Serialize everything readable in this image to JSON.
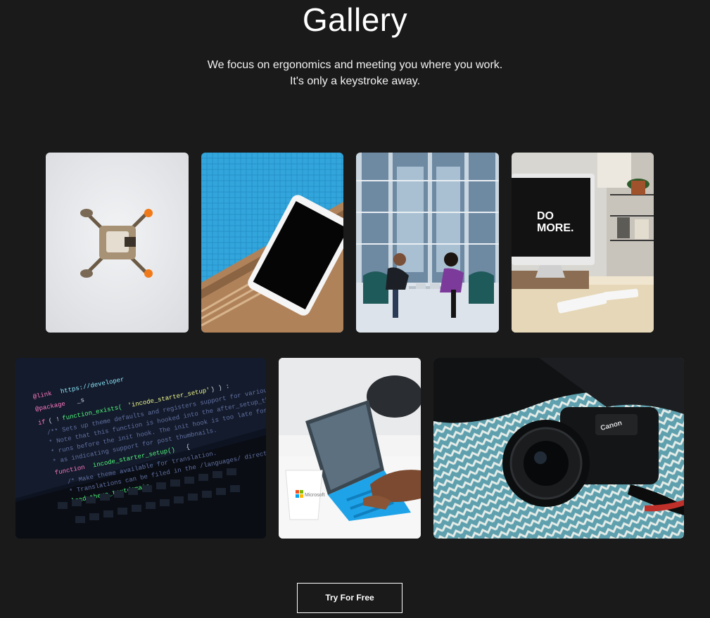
{
  "header": {
    "title": "Gallery",
    "subtitle_line1": "We focus on ergonomics and meeting you where you work.",
    "subtitle_line2": "It's only a keystroke away."
  },
  "gallery": {
    "images": [
      {
        "subject": "drone-from-above"
      },
      {
        "subject": "tablet-by-pool"
      },
      {
        "subject": "two-women-working-on-laptops"
      },
      {
        "subject": "imac-desk-setup",
        "screen_text": "DO MORE."
      },
      {
        "subject": "laptop-with-code"
      },
      {
        "subject": "surface-tablet-with-cup",
        "cup_text": "Microsoft"
      },
      {
        "subject": "canon-camera-on-blanket",
        "brand_text": "Canon"
      }
    ]
  },
  "cta": {
    "label": "Try For Free"
  },
  "colors": {
    "background": "#1a1a1a",
    "text": "#ffffff"
  }
}
